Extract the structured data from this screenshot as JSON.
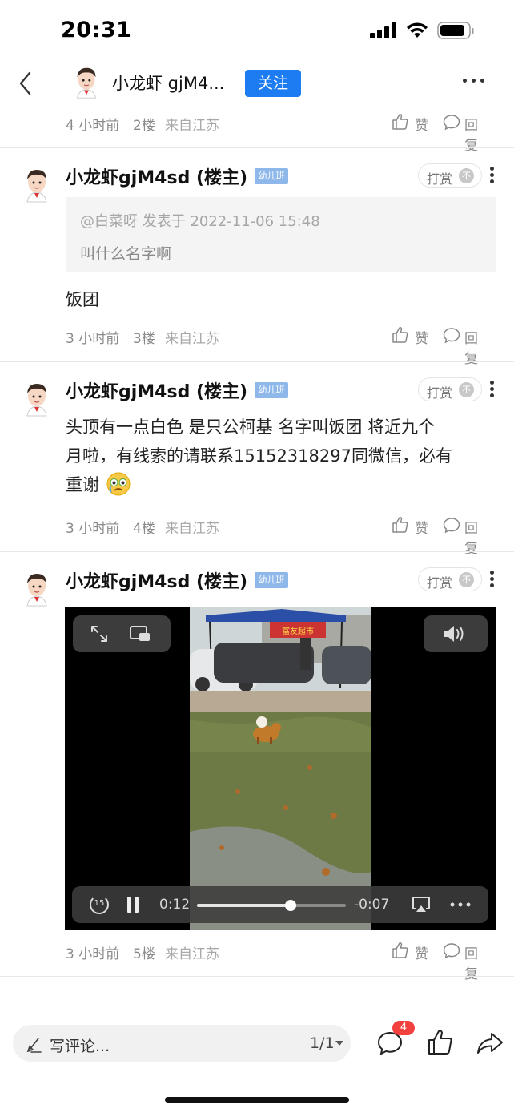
{
  "status_bar": {
    "time": "20:31"
  },
  "header": {
    "name": "小龙虾 gjM4...",
    "follow_label": "关注"
  },
  "first_meta": {
    "time": "4 小时前",
    "floor": "2楼",
    "location": "来自江苏",
    "like": "赞",
    "reply": "回复"
  },
  "posts": [
    {
      "author": "小龙虾gjM4sd (楼主)",
      "level": "幼儿班",
      "tip_label": "打赏",
      "tip_coin": "不",
      "quote": {
        "head": "@白菜呀 发表于 2022-11-06 15:48",
        "text": "叫什么名字啊"
      },
      "content": "饭团",
      "meta": {
        "time": "3 小时前",
        "floor": "3楼",
        "location": "来自江苏",
        "like": "赞",
        "reply": "回复"
      }
    },
    {
      "author": "小龙虾gjM4sd (楼主)",
      "level": "幼儿班",
      "tip_label": "打赏",
      "tip_coin": "不",
      "content_lines": [
        "头顶有一点白色 是只公柯基 名字叫饭团 将近九个",
        "月啦，有线索的请联系15152318297同微信，必有",
        "重谢"
      ],
      "meta": {
        "time": "3 小时前",
        "floor": "4楼",
        "location": "来自江苏",
        "like": "赞",
        "reply": "回复"
      }
    },
    {
      "author": "小龙虾gjM4sd (楼主)",
      "level": "幼儿班",
      "tip_label": "打赏",
      "tip_coin": "不",
      "video": {
        "current": "0:12",
        "remaining": "-0:07",
        "progress": 0.63,
        "skip_back_seconds": "15",
        "sign_text": "富友超市"
      },
      "meta": {
        "time": "3 小时前",
        "floor": "5楼",
        "location": "来自江苏",
        "like": "赞",
        "reply": "回复"
      }
    }
  ],
  "bottom_bar": {
    "comment_placeholder": "写评论...",
    "page": "1/1",
    "comment_count": "4"
  },
  "colors": {
    "accent": "#1e7cf2",
    "badge_red": "#f2413f",
    "level_badge": "#8fb8ea"
  }
}
